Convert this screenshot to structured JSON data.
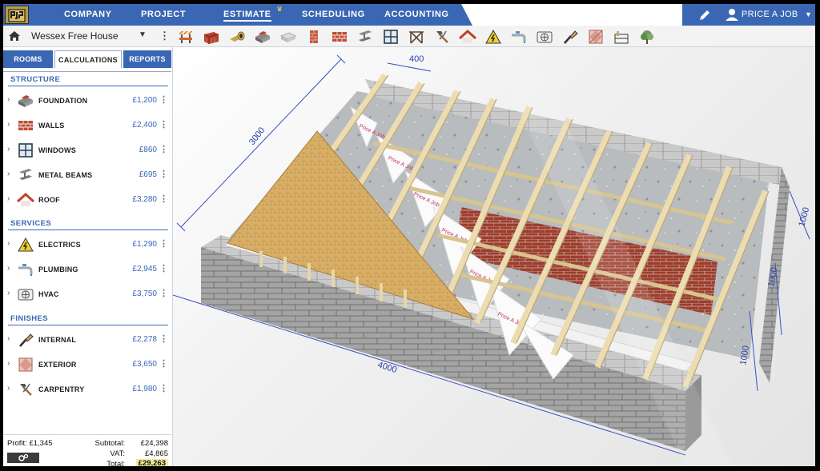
{
  "nav": {
    "items": [
      {
        "label": "COMPANY"
      },
      {
        "label": "PROJECT"
      },
      {
        "label": "ESTIMATE"
      },
      {
        "label": "SCHEDULING"
      },
      {
        "label": "ACCOUNTING"
      }
    ],
    "account_label": "PRICE A JOB"
  },
  "toolbar": {
    "project_name": "Wessex Free House",
    "tools": [
      "site-icon",
      "bricks-icon",
      "drainage-icon",
      "foundation-icon",
      "slab-icon",
      "wall-icon",
      "brickwork-icon",
      "steel-beam-icon",
      "window-icon",
      "frame-icon",
      "hammer-icon",
      "roof-icon",
      "electrics-icon",
      "plumbing-icon",
      "hvac-icon",
      "paint-icon",
      "exterior-icon",
      "fittings-icon",
      "landscaping-icon"
    ]
  },
  "tabs": {
    "rooms": "ROOMS",
    "calculations": "CALCULATIONS",
    "reports": "REPORTS"
  },
  "sections": {
    "structure": {
      "title": "STRUCTURE",
      "items": [
        {
          "label": "FOUNDATION",
          "value": "£1,200"
        },
        {
          "label": "WALLS",
          "value": "£2,400"
        },
        {
          "label": "WINDOWS",
          "value": "£860"
        },
        {
          "label": "METAL BEAMS",
          "value": "£695"
        },
        {
          "label": "ROOF",
          "value": "£3,280"
        }
      ]
    },
    "services": {
      "title": "SERVICES",
      "items": [
        {
          "label": "ELECTRICS",
          "value": "£1,290"
        },
        {
          "label": "PLUMBING",
          "value": "£2,945"
        },
        {
          "label": "HVAC",
          "value": "£3,750"
        }
      ]
    },
    "finishes": {
      "title": "FINISHES",
      "items": [
        {
          "label": "INTERNAL",
          "value": "£2,278"
        },
        {
          "label": "EXTERIOR",
          "value": "£3,650"
        },
        {
          "label": "CARPENTRY",
          "value": "£1,980"
        }
      ]
    }
  },
  "footer": {
    "profit": "Profit: £1,345",
    "subtotal_label": "Subtotal:",
    "subtotal": "£24,398",
    "vat_label": "VAT:",
    "vat": "£4,865",
    "total_label": "Total:",
    "total": "£29,263"
  },
  "drawing": {
    "dimensions": [
      "400",
      "3000",
      "4000",
      "1000",
      "1000",
      "1000"
    ],
    "membrane_text": "Price A Job"
  },
  "colors": {
    "nav_blue": "#3a67b3",
    "accent_blue": "#3a67b3",
    "total_highlight": "#f2ec9c",
    "timber": "#ecdcb0",
    "osb": "#d6ab63",
    "block": "#a9a9a9"
  }
}
